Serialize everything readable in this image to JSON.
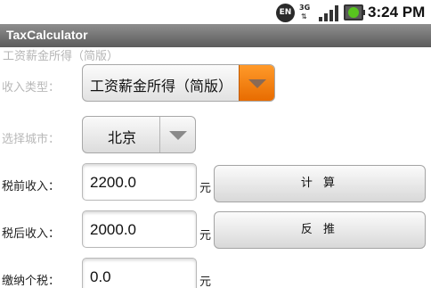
{
  "status_bar": {
    "ime": "EN",
    "network": "3G",
    "time": "3:24 PM",
    "icons": [
      "ime-en-icon",
      "network-3g-icon",
      "signal-icon",
      "battery-charging-icon"
    ]
  },
  "app": {
    "title": "TaxCalculator"
  },
  "breadcrumb": "工资薪金所得（简版）",
  "form": {
    "income_type": {
      "label": "收入类型：",
      "value": "工资薪金所得（简版）"
    },
    "city": {
      "label": "选择城市：",
      "value": "北京"
    },
    "pre_tax": {
      "label": "税前收入：",
      "value": "2200.0",
      "unit": "元",
      "button": "计 算"
    },
    "post_tax": {
      "label": "税后收入：",
      "value": "2000.0",
      "unit": "元",
      "button": "反 推"
    },
    "tax_paid": {
      "label": "缴纳个税：",
      "value": "0.0",
      "unit": "元"
    }
  },
  "colors": {
    "accent": "#f07a0f",
    "title_bar": "#6e6e6e",
    "muted_label": "#b8b8b8"
  }
}
